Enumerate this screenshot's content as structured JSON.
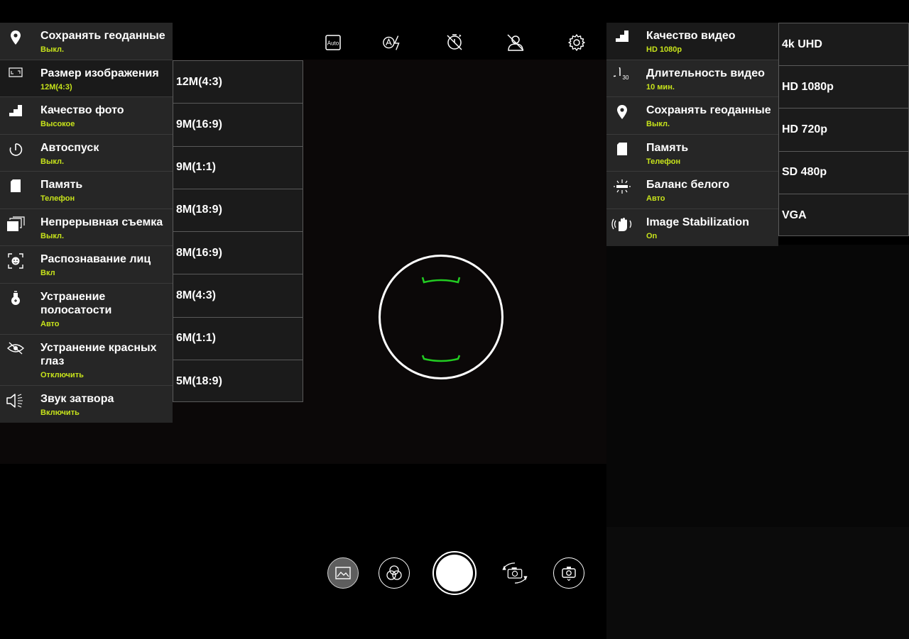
{
  "top_bar": {
    "icons": [
      "auto-mode-icon",
      "flash-auto-icon",
      "timer-off-icon",
      "face-off-icon",
      "settings-gear-icon"
    ],
    "auto_label": "Auto"
  },
  "photo_settings": {
    "items": [
      {
        "title": "Сохранять геоданные",
        "value": "Выкл.",
        "icon": "location-pin-icon"
      },
      {
        "title": "Размер изображения",
        "value": "12M(4:3)",
        "icon": "image-size-icon",
        "selected": true
      },
      {
        "title": "Качество фото",
        "value": "Высокое",
        "icon": "quality-stairs-icon"
      },
      {
        "title": "Автоспуск",
        "value": "Выкл.",
        "icon": "self-timer-icon"
      },
      {
        "title": "Память",
        "value": "Телефон",
        "icon": "sd-card-icon"
      },
      {
        "title": "Непрерывная съемка",
        "value": "Выкл.",
        "icon": "burst-icon"
      },
      {
        "title": "Распознавание лиц",
        "value": "Вкл",
        "icon": "face-detect-icon"
      },
      {
        "title": "Устранение полосатости",
        "value": "Авто",
        "icon": "anti-banding-icon"
      },
      {
        "title": "Устранение красных глаз",
        "value": "Отключить",
        "icon": "red-eye-icon"
      },
      {
        "title": "Звук затвора",
        "value": "Включить",
        "icon": "shutter-sound-icon"
      }
    ]
  },
  "image_size_options": [
    "12M(4:3)",
    "9M(16:9)",
    "9M(1:1)",
    "8M(18:9)",
    "8M(16:9)",
    "8M(4:3)",
    "6M(1:1)",
    "5M(18:9)"
  ],
  "video_settings": {
    "items": [
      {
        "title": "Качество видео",
        "value": "HD 1080p",
        "icon": "quality-stairs-icon",
        "selected": true
      },
      {
        "title": "Длительность видео",
        "value": "10 мин.",
        "icon": "duration-timer-icon"
      },
      {
        "title": "Сохранять геоданные",
        "value": "Выкл.",
        "icon": "location-pin-icon"
      },
      {
        "title": "Память",
        "value": "Телефон",
        "icon": "sd-card-icon"
      },
      {
        "title": "Баланс белого",
        "value": "Авто",
        "icon": "white-balance-icon"
      },
      {
        "title": "Image Stabilization",
        "value": "On",
        "icon": "stabilization-hand-icon"
      }
    ]
  },
  "video_quality_options": [
    "4k UHD",
    "HD 1080p",
    "HD 720p",
    "SD 480p",
    "VGA"
  ],
  "duration_icon_label": "30",
  "colors": {
    "accent": "#c7e31b",
    "focus": "#22cc22",
    "panel": "#262626"
  }
}
